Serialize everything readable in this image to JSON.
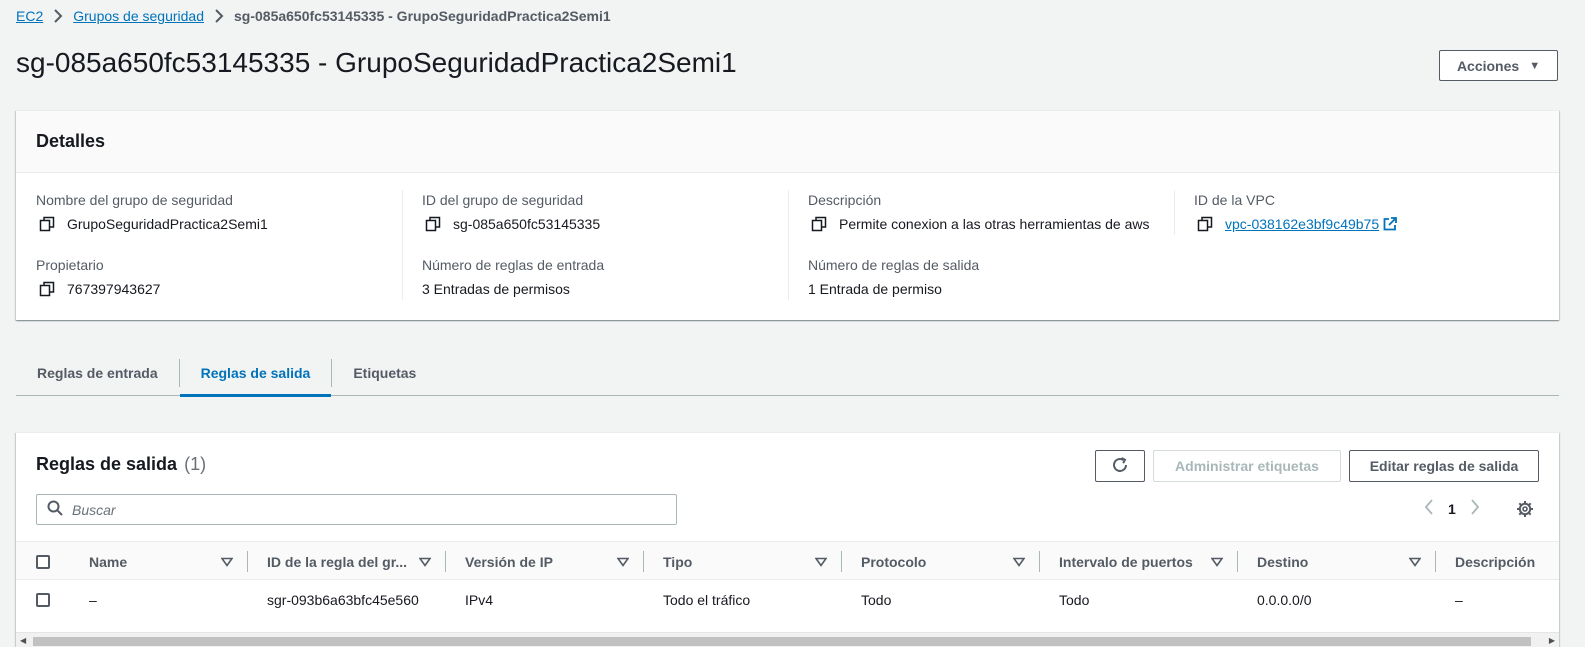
{
  "breadcrumb": {
    "items": [
      "EC2",
      "Grupos de seguridad"
    ],
    "current": "sg-085a650fc53145335 - GrupoSeguridadPractica2Semi1"
  },
  "page": {
    "title": "sg-085a650fc53145335 - GrupoSeguridadPractica2Semi1",
    "actions_label": "Acciones"
  },
  "details": {
    "title": "Detalles",
    "fields": {
      "sg_name": {
        "label": "Nombre del grupo de seguridad",
        "value": "GrupoSeguridadPractica2Semi1"
      },
      "sg_id": {
        "label": "ID del grupo de seguridad",
        "value": "sg-085a650fc53145335"
      },
      "description": {
        "label": "Descripción",
        "value": "Permite conexion a las otras herramientas de aws"
      },
      "vpc_id": {
        "label": "ID de la VPC",
        "value": "vpc-038162e3bf9c49b75"
      },
      "owner": {
        "label": "Propietario",
        "value": "767397943627"
      },
      "inbound_count": {
        "label": "Número de reglas de entrada",
        "value": "3 Entradas de permisos"
      },
      "outbound_count": {
        "label": "Número de reglas de salida",
        "value": "1 Entrada de permiso"
      }
    }
  },
  "tabs": [
    {
      "label": "Reglas de entrada",
      "active": false
    },
    {
      "label": "Reglas de salida",
      "active": true
    },
    {
      "label": "Etiquetas",
      "active": false
    }
  ],
  "rules": {
    "title": "Reglas de salida",
    "count": "(1)",
    "manage_tags_label": "Administrar etiquetas",
    "edit_label": "Editar reglas de salida",
    "search_placeholder": "Buscar",
    "page": "1",
    "columns": [
      "Name",
      "ID de la regla del gr...",
      "Versión de IP",
      "Tipo",
      "Protocolo",
      "Intervalo de puertos",
      "Destino",
      "Descripción"
    ],
    "rows": [
      [
        "–",
        "sgr-093b6a63bfc45e560",
        "IPv4",
        "Todo el tráfico",
        "Todo",
        "Todo",
        "0.0.0.0/0",
        "–"
      ]
    ]
  },
  "colors": {
    "link": "#0073bb",
    "text": "#16191f",
    "muted": "#545b64",
    "background": "#f2f3f3"
  }
}
